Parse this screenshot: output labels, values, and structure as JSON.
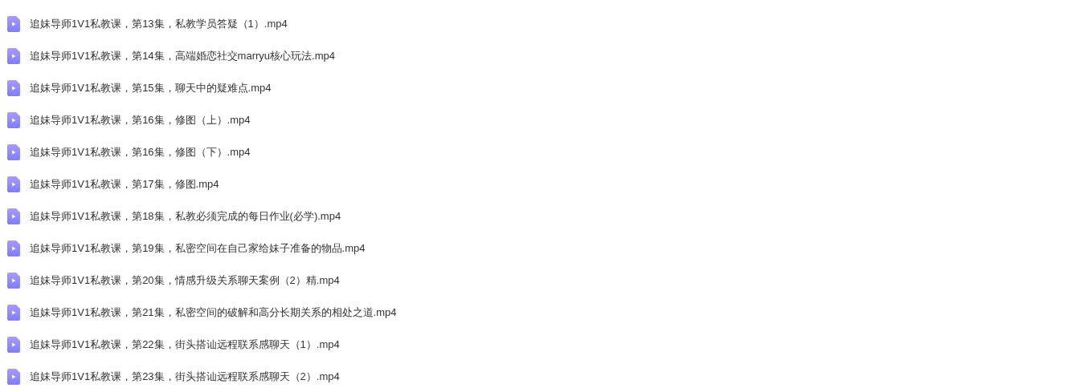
{
  "files": [
    {
      "name": "追妹导师1V1私教课，第13集，私教学员答疑（1）.mp4"
    },
    {
      "name": "追妹导师1V1私教课，第14集，高端婚恋社交marryu核心玩法.mp4"
    },
    {
      "name": "追妹导师1V1私教课，第15集，聊天中的疑难点.mp4"
    },
    {
      "name": "追妹导师1V1私教课，第16集，修图（上）.mp4"
    },
    {
      "name": "追妹导师1V1私教课，第16集，修图（下）.mp4"
    },
    {
      "name": "追妹导师1V1私教课，第17集，修图.mp4"
    },
    {
      "name": "追妹导师1V1私教课，第18集，私教必须完成的每日作业(必学).mp4"
    },
    {
      "name": "追妹导师1V1私教课，第19集，私密空间在自己家给妹子准备的物品.mp4"
    },
    {
      "name": "追妹导师1V1私教课，第20集，情感升级关系聊天案例（2）精.mp4"
    },
    {
      "name": "追妹导师1V1私教课，第21集，私密空间的破解和高分长期关系的相处之道.mp4"
    },
    {
      "name": "追妹导师1V1私教课，第22集，街头搭讪远程联系感聊天（1）.mp4"
    },
    {
      "name": "追妹导师1V1私教课，第23集，街头搭讪远程联系感聊天（2）.mp4"
    }
  ]
}
